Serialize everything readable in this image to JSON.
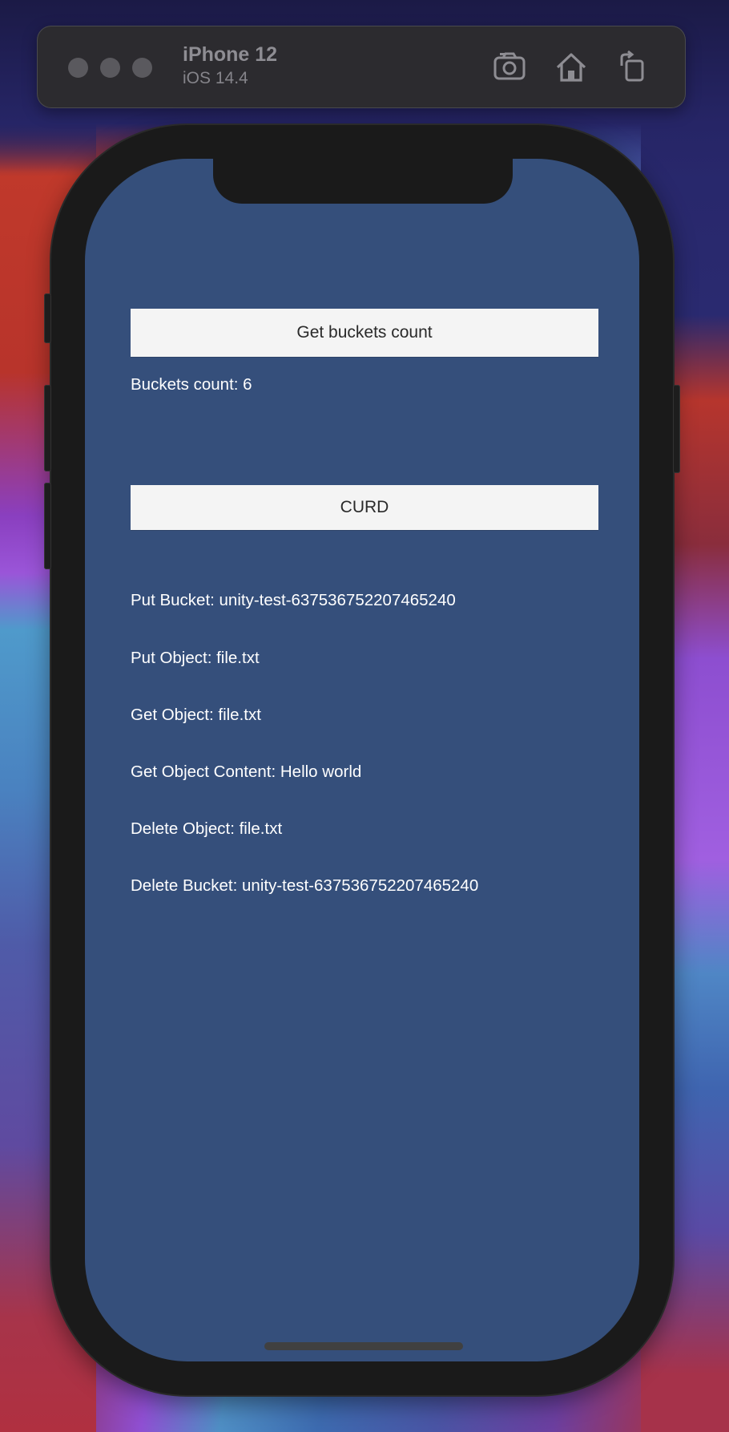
{
  "simulator": {
    "device_name": "iPhone 12",
    "os_version": "iOS 14.4",
    "toolbar_icons": [
      "screenshot-icon",
      "home-icon",
      "rotate-icon"
    ]
  },
  "app": {
    "get_buckets_button_label": "Get buckets count",
    "buckets_count_text": "Buckets count: 6",
    "curd_button_label": "CURD",
    "log_lines": [
      "Put Bucket: unity-test-637536752207465240",
      "Put Object: file.txt",
      "Get Object: file.txt",
      "Get Object Content: Hello world",
      "Delete Object: file.txt",
      "Delete Bucket: unity-test-637536752207465240"
    ]
  },
  "colors": {
    "screen_background": "#354f7b",
    "button_background": "#f4f4f4",
    "text_color": "#ffffff"
  }
}
